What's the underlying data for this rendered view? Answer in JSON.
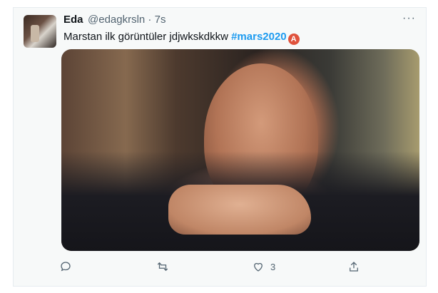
{
  "tweet": {
    "name": "Eda",
    "handle": "@edagkrsln · 7s",
    "text": "Marstan ilk görüntüler jdjwkskdkkw ",
    "hashtag": "#mars2020",
    "emoji_letter": "A",
    "more": "···"
  },
  "actions": {
    "reply_icon": "reply-icon",
    "retweet_icon": "retweet-icon",
    "like_icon": "heart-icon",
    "like_count": "3",
    "share_icon": "share-icon"
  },
  "colors": {
    "hashtag": "#1d9bf0",
    "text": "#0f1419",
    "muted": "#536471"
  }
}
